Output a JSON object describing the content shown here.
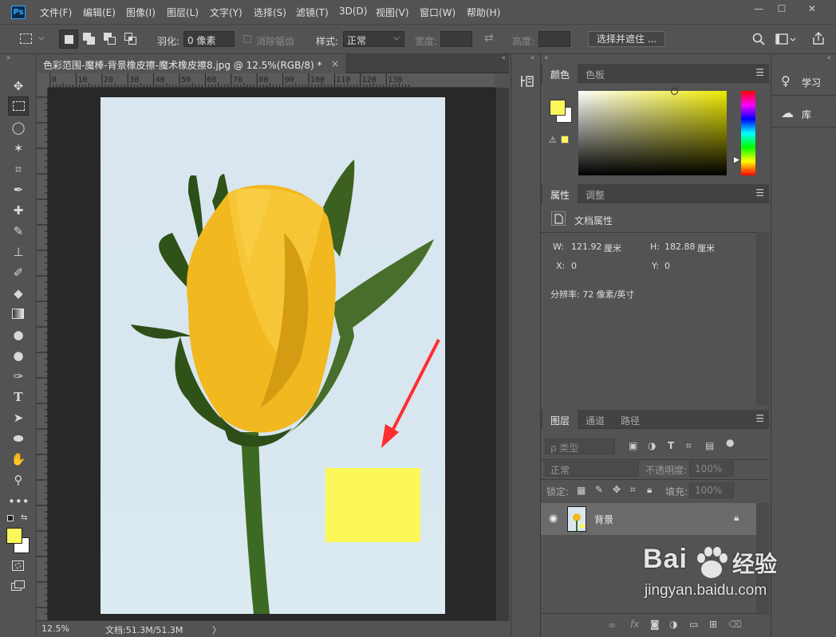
{
  "app": {
    "logo": "Ps",
    "menus": [
      "文件(F)",
      "编辑(E)",
      "图像(I)",
      "图层(L)",
      "文字(Y)",
      "选择(S)",
      "滤镜(T)",
      "3D(D)",
      "视图(V)",
      "窗口(W)",
      "帮助(H)"
    ],
    "window_controls": [
      "—",
      "☐",
      "✕"
    ]
  },
  "options": {
    "feather_label": "羽化:",
    "feather_value": "0 像素",
    "antialias_label": "消除锯齿",
    "style_label": "样式:",
    "style_value": "正常",
    "width_label": "宽度:",
    "height_label": "高度:",
    "select_mask_button": "选择并遮住 ..."
  },
  "document": {
    "tab_title": "色彩范围-魔棒-背景橡皮擦-魔术橡皮擦8.jpg @ 12.5%(RGB/8) *",
    "close": "×",
    "ruler_ticks": [
      "0",
      "10",
      "20",
      "30",
      "40",
      "50",
      "60",
      "70",
      "80",
      "90",
      "100",
      "110",
      "120",
      "130"
    ],
    "zoom": "12.5%",
    "doc_size": "文档:51.3M/51.3M",
    "status_arrow": "〉"
  },
  "color_panel": {
    "tabs": [
      "颜色",
      "色板"
    ],
    "foreground": "#fdf85a",
    "background": "#ffffff",
    "warning_icon": "⚠"
  },
  "properties_panel": {
    "tabs": [
      "属性",
      "调整"
    ],
    "heading": "文档属性",
    "w_label": "W:",
    "w_value": "121.92",
    "w_unit": "厘米",
    "h_label": "H:",
    "h_value": "182.88",
    "h_unit": "厘米",
    "x_label": "X:",
    "x_value": "0",
    "y_label": "Y:",
    "y_value": "0",
    "resolution": "分辨率: 72 像素/英寸"
  },
  "layers_panel": {
    "tabs": [
      "图层",
      "通道",
      "路径"
    ],
    "filter_label": "ρ 类型",
    "blend_mode": "正常",
    "opacity_label": "不透明度:",
    "opacity_value": "100%",
    "lock_label": "锁定:",
    "fill_label": "填充:",
    "fill_value": "100%",
    "layers": [
      {
        "name": "背景",
        "visible": true,
        "locked": true
      }
    ],
    "bottom_icons": [
      "link-icon",
      "fx-icon",
      "mask-icon",
      "adjustment-icon",
      "folder-icon",
      "new-layer-icon",
      "trash-icon"
    ],
    "fx_text": "fx"
  },
  "library": {
    "items": [
      "学习",
      "库"
    ]
  },
  "watermark": {
    "brand": "Bai",
    "brand2": "经验",
    "url": "jingyan.baidu.com"
  },
  "image_content": {
    "yellow_swatch": "#fdf85a",
    "arrow_color": "#ff2d2d"
  }
}
